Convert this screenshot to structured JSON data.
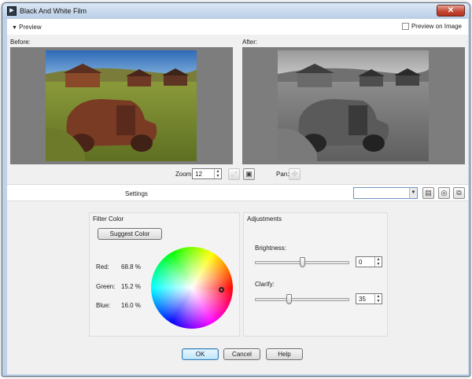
{
  "window": {
    "title": "Black And White Film",
    "close_glyph": "✕"
  },
  "preview_bar": {
    "toggle_label": "Preview",
    "preview_on_image_label": "Preview on Image",
    "preview_on_image_checked": false
  },
  "before_label": "Before:",
  "after_label": "After:",
  "zoom": {
    "label": "Zoom:",
    "value": "12"
  },
  "pan": {
    "label": "Pan:"
  },
  "settings": {
    "label": "Settings",
    "preset_value": ""
  },
  "filter_color": {
    "title": "Filter Color",
    "suggest_button": "Suggest Color",
    "red_label": "Red:",
    "red_value": "68.8 %",
    "green_label": "Green:",
    "green_value": "15.2 %",
    "blue_label": "Blue:",
    "blue_value": "16.0 %"
  },
  "adjustments": {
    "title": "Adjustments",
    "brightness_label": "Brightness:",
    "brightness_value": "0",
    "brightness_level": 0.5,
    "clarify_label": "Clarify:",
    "clarify_value": "35",
    "clarify_level": 0.35
  },
  "footer": {
    "ok": "OK",
    "cancel": "Cancel",
    "help": "Help"
  },
  "icons": {
    "app": "app-icon",
    "close": "close-icon",
    "zoom_fit": "zoom-fit-icon",
    "zoom_actual": "zoom-actual-icon",
    "pan": "pan-icon",
    "save_preset": "save-icon",
    "reset_preset": "reset-icon",
    "delete_preset": "delete-preset-icon"
  },
  "colors": {
    "accent": "#3c7fb1",
    "panel_gray": "#7d7d7d"
  }
}
